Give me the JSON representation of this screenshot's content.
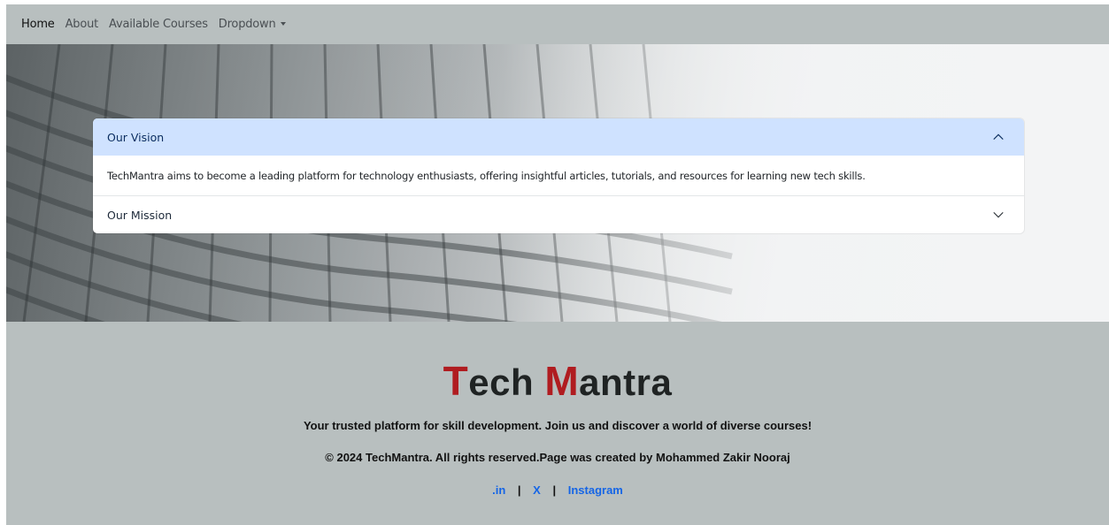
{
  "navbar": {
    "items": [
      {
        "label": "Home"
      },
      {
        "label": "About"
      },
      {
        "label": "Available Courses"
      },
      {
        "label": "Dropdown"
      }
    ]
  },
  "accordion": {
    "items": [
      {
        "title": "Our Vision",
        "expanded": true,
        "body": "TechMantra aims to become a leading platform for technology enthusiasts, offering insightful articles, tutorials, and resources for learning new tech skills."
      },
      {
        "title": "Our Mission",
        "expanded": false
      }
    ],
    "open_header_color": "#cfe2ff"
  },
  "footer": {
    "brand": {
      "t1": "T",
      "t2": "ech ",
      "m1": "M",
      "m2": "antra",
      "accent_color": "#b01c20"
    },
    "tagline": "Your trusted platform for skill development. Join us and discover a world of diverse courses!",
    "copyright": "© 2024 TechMantra. All rights reserved.Page was created by Mohammed Zakir Nooraj",
    "links": [
      {
        "label": ".in"
      },
      {
        "label": "X"
      },
      {
        "label": "Instagram"
      }
    ],
    "separator": "|",
    "link_color": "#1565e6"
  },
  "theme": {
    "background": "#b8bfbf"
  }
}
